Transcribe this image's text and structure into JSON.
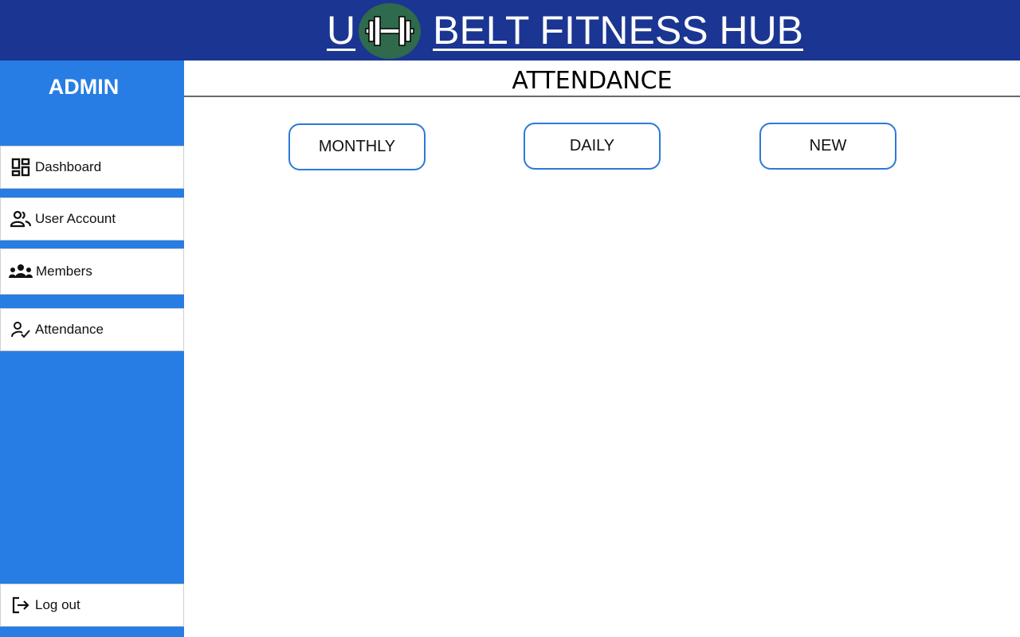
{
  "header": {
    "title_prefix": "U",
    "title_suffix": "BELT FITNESS HUB",
    "logo_icon": "dumbbell-icon"
  },
  "sidebar": {
    "title": "ADMIN",
    "items": [
      {
        "label": "Dashboard",
        "icon": "dashboard-icon"
      },
      {
        "label": "User Account",
        "icon": "users-icon"
      },
      {
        "label": "Members",
        "icon": "group-icon"
      },
      {
        "label": "Attendance",
        "icon": "person-check-icon"
      }
    ],
    "logout": {
      "label": "Log out",
      "icon": "logout-icon"
    }
  },
  "main": {
    "title": "ATTENDANCE",
    "buttons": {
      "monthly": "MONTHLY",
      "daily": "DAILY",
      "new": "NEW"
    }
  },
  "colors": {
    "header_bg": "#1b3592",
    "sidebar_bg": "#277de3",
    "logo_bg": "#2f6a4c",
    "button_border": "#2b7ad6"
  }
}
